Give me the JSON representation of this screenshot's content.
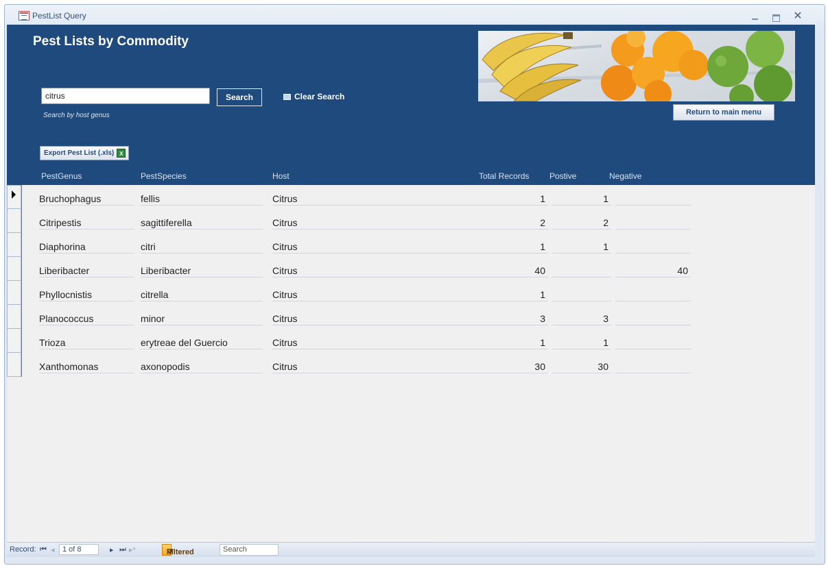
{
  "window": {
    "title": "PestList Query"
  },
  "form": {
    "title": "Pest Lists by Commodity",
    "search": {
      "value": "citrus",
      "placeholder": ""
    },
    "search_hint": "Search by host genus",
    "search_label": "Search",
    "clear_label": "Clear Search",
    "return_label": "Return to main menu",
    "export_label": "Export Pest List (.xls)"
  },
  "columns": {
    "genus": "PestGenus",
    "species": "PestSpecies",
    "host": "Host",
    "total": "Total Records",
    "positive": "Postive",
    "negative": "Negative"
  },
  "records": [
    {
      "genus": "Bruchophagus",
      "species": "fellis",
      "host": "Citrus",
      "total": "1",
      "positive": "1",
      "negative": ""
    },
    {
      "genus": "Citripestis",
      "species": "sagittiferella",
      "host": "Citrus",
      "total": "2",
      "positive": "2",
      "negative": ""
    },
    {
      "genus": "Diaphorina",
      "species": "citri",
      "host": "Citrus",
      "total": "1",
      "positive": "1",
      "negative": ""
    },
    {
      "genus": "Liberibacter",
      "species": "Liberibacter",
      "host": "Citrus",
      "total": "40",
      "positive": "",
      "negative": "40"
    },
    {
      "genus": "Phyllocnistis",
      "species": "citrella",
      "host": "Citrus",
      "total": "1",
      "positive": "",
      "negative": ""
    },
    {
      "genus": "Planococcus",
      "species": "minor",
      "host": "Citrus",
      "total": "3",
      "positive": "3",
      "negative": ""
    },
    {
      "genus": "Trioza",
      "species": "erytreae del Guercio",
      "host": "Citrus",
      "total": "1",
      "positive": "1",
      "negative": ""
    },
    {
      "genus": "Xanthomonas",
      "species": "axonopodis",
      "host": "Citrus",
      "total": "30",
      "positive": "30",
      "negative": ""
    }
  ],
  "navigation": {
    "record_label": "Record:",
    "counter": "1 of 8",
    "filter_label": "Filtered",
    "search_label": "Search"
  },
  "colors": {
    "header_bg": "#1f4a7d",
    "form_bg": "#f0f0f0",
    "filter_accent": "#f5a623"
  },
  "icons": {
    "first": "first-record-icon",
    "prev": "previous-record-icon",
    "next": "next-record-icon",
    "last": "last-record-icon",
    "new": "new-record-icon",
    "filter": "filter-icon",
    "excel": "excel-icon",
    "clear": "clear-search-icon"
  }
}
